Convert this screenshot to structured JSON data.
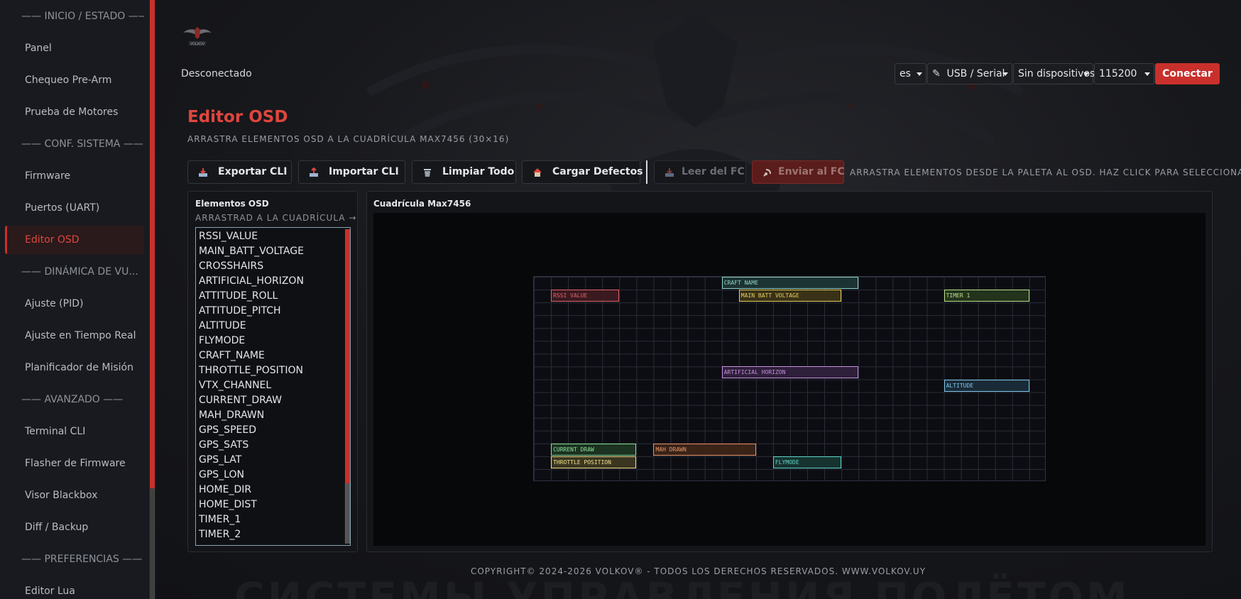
{
  "sidebar": {
    "sections": [
      {
        "label": "—— INICIO / ESTADO ——"
      },
      {
        "label": "—— CONF. SISTEMA ——"
      },
      {
        "label": "—— DINÁMICA DE VU..."
      },
      {
        "label": "—— AVANZADO ——"
      },
      {
        "label": "—— PREFERENCIAS ——"
      }
    ],
    "items": [
      {
        "label": "Panel"
      },
      {
        "label": "Chequeo Pre-Arm"
      },
      {
        "label": "Prueba de Motores"
      },
      {
        "label": "Firmware"
      },
      {
        "label": "Puertos (UART)"
      },
      {
        "label": "Editor OSD"
      },
      {
        "label": "Ajuste (PID)"
      },
      {
        "label": "Ajuste en Tiempo Real"
      },
      {
        "label": "Planificador de Misión"
      },
      {
        "label": "Terminal CLI"
      },
      {
        "label": "Flasher de Firmware"
      },
      {
        "label": "Visor Blackbox"
      },
      {
        "label": "Diff / Backup"
      },
      {
        "label": "Editor Lua"
      }
    ],
    "active_item": "Editor OSD"
  },
  "header": {
    "logo_text": "VOLKOV",
    "status": "Desconectado",
    "language": "es",
    "connection_type": "USB / Serial",
    "connection_icon": "plug-icon",
    "device": "Sin dispositivos",
    "baud": "115200",
    "connect_label": "Conectar"
  },
  "page": {
    "title": "Editor OSD",
    "subtitle": "ARRASTRA ELEMENTOS OSD A LA CUADRÍCULA MAX7456 (30×16)"
  },
  "toolbar": {
    "export": "Exportar CLI",
    "import": "Importar CLI",
    "clear": "Limpiar Todo",
    "defaults": "Cargar Defectos",
    "read": "Leer del FC",
    "send": "Enviar al FC",
    "hint": "ARRASTRA ELEMENTOS DESDE LA PALETA AL OSD. HAZ CLICK PARA SELECCIONAR."
  },
  "palette": {
    "title": "Elementos OSD",
    "hint": "ARRASTRAD A LA CUADRÍCULA →",
    "items": [
      "RSSI_VALUE",
      "MAIN_BATT_VOLTAGE",
      "CROSSHAIRS",
      "ARTIFICIAL_HORIZON",
      "ATTITUDE_ROLL",
      "ATTITUDE_PITCH",
      "ALTITUDE",
      "FLYMODE",
      "CRAFT_NAME",
      "THROTTLE_POSITION",
      "VTX_CHANNEL",
      "CURRENT_DRAW",
      "MAH_DRAWN",
      "GPS_SPEED",
      "GPS_SATS",
      "GPS_LAT",
      "GPS_LON",
      "HOME_DIR",
      "HOME_DIST",
      "TIMER_1",
      "TIMER_2"
    ]
  },
  "grid": {
    "title": "Cuadrícula Max7456",
    "cols": 30,
    "rows": 16,
    "elements": [
      {
        "label": "CRAFT NAME",
        "col": 11,
        "row": 0,
        "width": 8,
        "color": "#8fd3c9",
        "bg": "#1c3333"
      },
      {
        "label": "RSSI VALUE",
        "col": 1,
        "row": 1,
        "width": 4,
        "color": "#e0626b",
        "bg": "#3a1a20"
      },
      {
        "label": "MAIN BATT VOLTAGE",
        "col": 12,
        "row": 1,
        "width": 6,
        "color": "#e8cf5a",
        "bg": "#3a3218"
      },
      {
        "label": "TIMER 1",
        "col": 24,
        "row": 1,
        "width": 5,
        "color": "#b8e08a",
        "bg": "#24331c"
      },
      {
        "label": "ARTIFICIAL HORIZON",
        "col": 11,
        "row": 7,
        "width": 8,
        "color": "#c98fe0",
        "bg": "#2e1f3a"
      },
      {
        "label": "ALTITUDE",
        "col": 24,
        "row": 8,
        "width": 5,
        "color": "#7fc6e8",
        "bg": "#1a2b38"
      },
      {
        "label": "CURRENT DRAW",
        "col": 1,
        "row": 13,
        "width": 5,
        "color": "#8fe09a",
        "bg": "#1c3322"
      },
      {
        "label": "MAH DRAWN",
        "col": 7,
        "row": 13,
        "width": 6,
        "color": "#e8946a",
        "bg": "#3a2418"
      },
      {
        "label": "THROTTLE POSITION",
        "col": 1,
        "row": 14,
        "width": 5,
        "color": "#f0e08a",
        "bg": "#3a3620"
      },
      {
        "label": "FLYMODE",
        "col": 14,
        "row": 14,
        "width": 4,
        "color": "#5fd6c8",
        "bg": "#163330"
      }
    ]
  },
  "footer": "COPYRIGHT© 2024-2026 VOLKOV® - TODOS LOS DERECHOS RESERVADOS. WWW.VOLKOV.UY",
  "background_text": "СИСТЕМЫ УПРАВЛЕНИЯ ПОЛЁТОМ",
  "colors": {
    "accent": "#c9302c",
    "accent_text": "#e0463d",
    "sidebar_bg": "#181a1f",
    "panel_bg": "#141519"
  }
}
